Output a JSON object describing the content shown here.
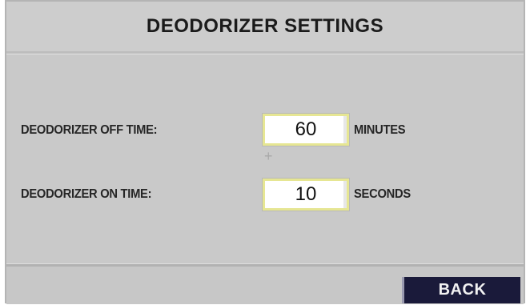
{
  "header": {
    "title": "DEODORIZER SETTINGS"
  },
  "settings": [
    {
      "label": "DEODORIZER OFF TIME:",
      "value": "60",
      "unit": "MINUTES"
    },
    {
      "label": "DEODORIZER ON TIME:",
      "value": "10",
      "unit": "SECONDS"
    }
  ],
  "footer": {
    "back_label": "BACK"
  },
  "colors": {
    "background": "#c9c9c9",
    "field_border": "#e6e693",
    "back_button": "#1a1a3a"
  }
}
